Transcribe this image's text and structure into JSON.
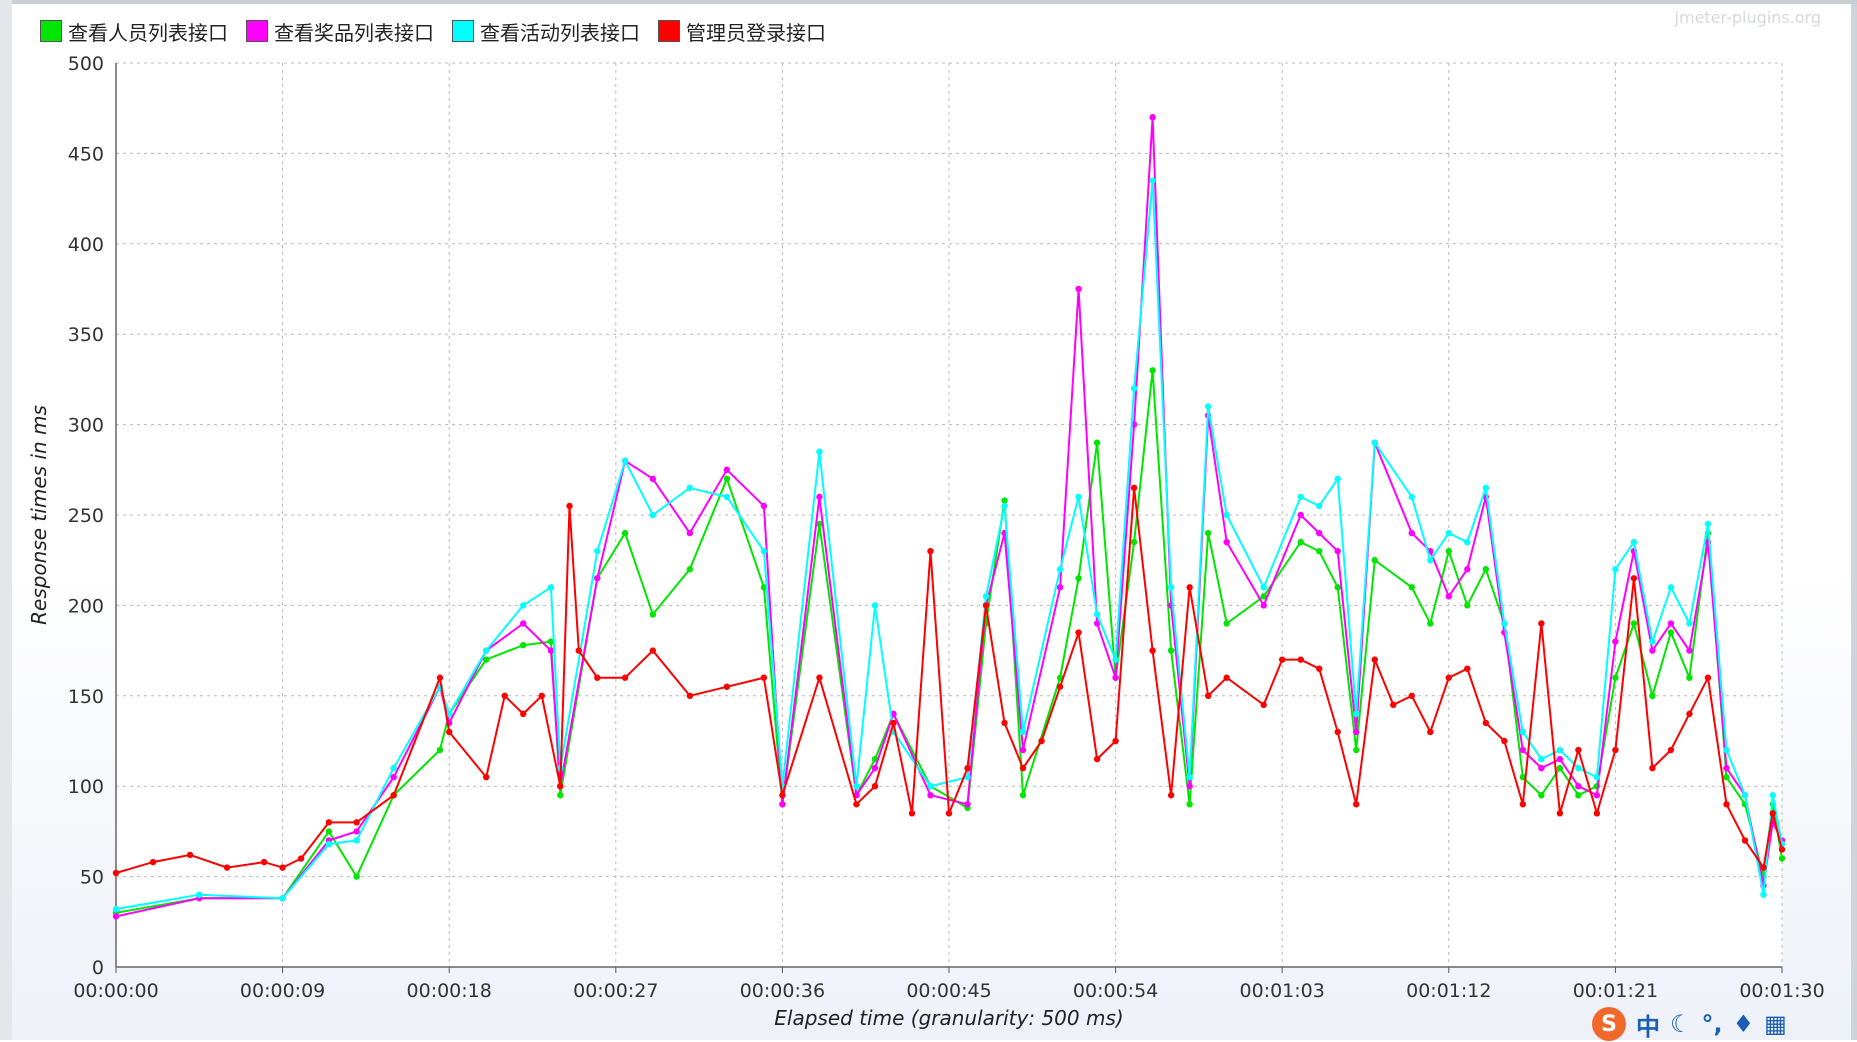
{
  "window": {
    "watermark": "jmeter-plugins.org"
  },
  "tray": {
    "logo": "S",
    "text": "中",
    "icons": [
      "ime-logo-icon",
      "moon-icon",
      "punctuation-icon",
      "shirt-icon",
      "grid-icon"
    ]
  },
  "chart_data": {
    "type": "line",
    "title": "",
    "xlabel": "Elapsed time (granularity: 500 ms)",
    "ylabel": "Response times in ms",
    "ylim": [
      0,
      500
    ],
    "yticks": [
      0,
      50,
      100,
      150,
      200,
      250,
      300,
      350,
      400,
      450,
      500
    ],
    "xlim_seconds": [
      0,
      90
    ],
    "xtick_seconds": [
      0,
      9,
      18,
      27,
      36,
      45,
      54,
      63,
      72,
      81,
      90
    ],
    "xticks": [
      "00:00:00",
      "00:00:09",
      "00:00:18",
      "00:00:27",
      "00:00:36",
      "00:00:45",
      "00:00:54",
      "00:01:03",
      "00:01:12",
      "00:01:21",
      "00:01:30"
    ],
    "grid": true,
    "legend_position": "top-left",
    "series": [
      {
        "name": "查看人员列表接口",
        "color": "#00e600",
        "points": [
          [
            0,
            30
          ],
          [
            4.5,
            38
          ],
          [
            9,
            38
          ],
          [
            11.5,
            75
          ],
          [
            13,
            50
          ],
          [
            15,
            95
          ],
          [
            17.5,
            120
          ],
          [
            18,
            140
          ],
          [
            20,
            170
          ],
          [
            22,
            178
          ],
          [
            23.5,
            180
          ],
          [
            24,
            95
          ],
          [
            26,
            215
          ],
          [
            27.5,
            240
          ],
          [
            29,
            195
          ],
          [
            31,
            220
          ],
          [
            33,
            270
          ],
          [
            35,
            210
          ],
          [
            36,
            90
          ],
          [
            38,
            245
          ],
          [
            40,
            95
          ],
          [
            41,
            115
          ],
          [
            42,
            140
          ],
          [
            44,
            100
          ],
          [
            46,
            88
          ],
          [
            47,
            190
          ],
          [
            48,
            258
          ],
          [
            49,
            95
          ],
          [
            51,
            160
          ],
          [
            52,
            215
          ],
          [
            53,
            290
          ],
          [
            54,
            160
          ],
          [
            55,
            235
          ],
          [
            56,
            330
          ],
          [
            57,
            175
          ],
          [
            58,
            90
          ],
          [
            59,
            240
          ],
          [
            60,
            190
          ],
          [
            62,
            205
          ],
          [
            64,
            235
          ],
          [
            65,
            230
          ],
          [
            66,
            210
          ],
          [
            67,
            120
          ],
          [
            68,
            225
          ],
          [
            70,
            210
          ],
          [
            71,
            190
          ],
          [
            72,
            230
          ],
          [
            73,
            200
          ],
          [
            74,
            220
          ],
          [
            75,
            190
          ],
          [
            76,
            105
          ],
          [
            77,
            95
          ],
          [
            78,
            110
          ],
          [
            79,
            95
          ],
          [
            80,
            100
          ],
          [
            81,
            160
          ],
          [
            82,
            190
          ],
          [
            83,
            150
          ],
          [
            84,
            185
          ],
          [
            85,
            160
          ],
          [
            86,
            240
          ],
          [
            87,
            105
          ],
          [
            88,
            90
          ],
          [
            89,
            50
          ],
          [
            89.5,
            90
          ],
          [
            90,
            60
          ]
        ]
      },
      {
        "name": "查看奖品列表接口",
        "color": "#ff00ff",
        "points": [
          [
            0,
            28
          ],
          [
            4.5,
            38
          ],
          [
            9,
            38
          ],
          [
            11.5,
            70
          ],
          [
            13,
            75
          ],
          [
            15,
            105
          ],
          [
            17.5,
            155
          ],
          [
            18,
            135
          ],
          [
            20,
            175
          ],
          [
            22,
            190
          ],
          [
            23.5,
            175
          ],
          [
            24,
            100
          ],
          [
            26,
            215
          ],
          [
            27.5,
            280
          ],
          [
            29,
            270
          ],
          [
            31,
            240
          ],
          [
            33,
            275
          ],
          [
            35,
            255
          ],
          [
            36,
            90
          ],
          [
            38,
            260
          ],
          [
            40,
            95
          ],
          [
            41,
            110
          ],
          [
            42,
            140
          ],
          [
            44,
            95
          ],
          [
            46,
            90
          ],
          [
            47,
            200
          ],
          [
            48,
            240
          ],
          [
            49,
            120
          ],
          [
            51,
            210
          ],
          [
            52,
            375
          ],
          [
            53,
            190
          ],
          [
            54,
            160
          ],
          [
            55,
            300
          ],
          [
            56,
            470
          ],
          [
            57,
            200
          ],
          [
            58,
            100
          ],
          [
            59,
            305
          ],
          [
            60,
            235
          ],
          [
            62,
            200
          ],
          [
            64,
            250
          ],
          [
            65,
            240
          ],
          [
            66,
            230
          ],
          [
            67,
            130
          ],
          [
            68,
            290
          ],
          [
            70,
            240
          ],
          [
            71,
            230
          ],
          [
            72,
            205
          ],
          [
            73,
            220
          ],
          [
            74,
            260
          ],
          [
            75,
            185
          ],
          [
            76,
            120
          ],
          [
            77,
            110
          ],
          [
            78,
            115
          ],
          [
            79,
            100
          ],
          [
            80,
            95
          ],
          [
            81,
            180
          ],
          [
            82,
            230
          ],
          [
            83,
            175
          ],
          [
            84,
            190
          ],
          [
            85,
            175
          ],
          [
            86,
            235
          ],
          [
            87,
            110
          ],
          [
            88,
            95
          ],
          [
            89,
            45
          ],
          [
            89.5,
            80
          ],
          [
            90,
            70
          ]
        ]
      },
      {
        "name": "查看活动列表接口",
        "color": "#00ffff",
        "points": [
          [
            0,
            32
          ],
          [
            4.5,
            40
          ],
          [
            9,
            38
          ],
          [
            11.5,
            68
          ],
          [
            13,
            70
          ],
          [
            15,
            110
          ],
          [
            17.5,
            155
          ],
          [
            18,
            140
          ],
          [
            20,
            175
          ],
          [
            22,
            200
          ],
          [
            23.5,
            210
          ],
          [
            24,
            110
          ],
          [
            26,
            230
          ],
          [
            27.5,
            280
          ],
          [
            29,
            250
          ],
          [
            31,
            265
          ],
          [
            33,
            260
          ],
          [
            35,
            230
          ],
          [
            36,
            100
          ],
          [
            38,
            285
          ],
          [
            40,
            100
          ],
          [
            41,
            200
          ],
          [
            42,
            130
          ],
          [
            44,
            100
          ],
          [
            46,
            105
          ],
          [
            47,
            205
          ],
          [
            48,
            255
          ],
          [
            49,
            130
          ],
          [
            51,
            220
          ],
          [
            52,
            260
          ],
          [
            53,
            195
          ],
          [
            54,
            170
          ],
          [
            55,
            320
          ],
          [
            56,
            435
          ],
          [
            57,
            210
          ],
          [
            58,
            105
          ],
          [
            59,
            310
          ],
          [
            60,
            250
          ],
          [
            62,
            210
          ],
          [
            64,
            260
          ],
          [
            65,
            255
          ],
          [
            66,
            270
          ],
          [
            67,
            140
          ],
          [
            68,
            290
          ],
          [
            70,
            260
          ],
          [
            71,
            225
          ],
          [
            72,
            240
          ],
          [
            73,
            235
          ],
          [
            74,
            265
          ],
          [
            75,
            190
          ],
          [
            76,
            130
          ],
          [
            77,
            115
          ],
          [
            78,
            120
          ],
          [
            79,
            110
          ],
          [
            80,
            105
          ],
          [
            81,
            220
          ],
          [
            82,
            235
          ],
          [
            83,
            180
          ],
          [
            84,
            210
          ],
          [
            85,
            190
          ],
          [
            86,
            245
          ],
          [
            87,
            120
          ],
          [
            88,
            95
          ],
          [
            89,
            40
          ],
          [
            89.5,
            95
          ],
          [
            90,
            68
          ]
        ]
      },
      {
        "name": "管理员登录接口",
        "color": "#ff0000",
        "points": [
          [
            0,
            52
          ],
          [
            2,
            58
          ],
          [
            4,
            62
          ],
          [
            6,
            55
          ],
          [
            8,
            58
          ],
          [
            9,
            55
          ],
          [
            10,
            60
          ],
          [
            11.5,
            80
          ],
          [
            13,
            80
          ],
          [
            15,
            95
          ],
          [
            17.5,
            160
          ],
          [
            18,
            130
          ],
          [
            20,
            105
          ],
          [
            21,
            150
          ],
          [
            22,
            140
          ],
          [
            23,
            150
          ],
          [
            24,
            100
          ],
          [
            24.5,
            255
          ],
          [
            25,
            175
          ],
          [
            26,
            160
          ],
          [
            27.5,
            160
          ],
          [
            29,
            175
          ],
          [
            31,
            150
          ],
          [
            33,
            155
          ],
          [
            35,
            160
          ],
          [
            36,
            95
          ],
          [
            38,
            160
          ],
          [
            40,
            90
          ],
          [
            41,
            100
          ],
          [
            42,
            135
          ],
          [
            43,
            85
          ],
          [
            44,
            230
          ],
          [
            45,
            85
          ],
          [
            46,
            110
          ],
          [
            47,
            200
          ],
          [
            48,
            135
          ],
          [
            49,
            110
          ],
          [
            50,
            125
          ],
          [
            51,
            155
          ],
          [
            52,
            185
          ],
          [
            53,
            115
          ],
          [
            54,
            125
          ],
          [
            55,
            265
          ],
          [
            56,
            175
          ],
          [
            57,
            95
          ],
          [
            58,
            210
          ],
          [
            59,
            150
          ],
          [
            60,
            160
          ],
          [
            62,
            145
          ],
          [
            63,
            170
          ],
          [
            64,
            170
          ],
          [
            65,
            165
          ],
          [
            66,
            130
          ],
          [
            67,
            90
          ],
          [
            68,
            170
          ],
          [
            69,
            145
          ],
          [
            70,
            150
          ],
          [
            71,
            130
          ],
          [
            72,
            160
          ],
          [
            73,
            165
          ],
          [
            74,
            135
          ],
          [
            75,
            125
          ],
          [
            76,
            90
          ],
          [
            77,
            190
          ],
          [
            78,
            85
          ],
          [
            79,
            120
          ],
          [
            80,
            85
          ],
          [
            81,
            120
          ],
          [
            82,
            215
          ],
          [
            83,
            110
          ],
          [
            84,
            120
          ],
          [
            85,
            140
          ],
          [
            86,
            160
          ],
          [
            87,
            90
          ],
          [
            88,
            70
          ],
          [
            89,
            55
          ],
          [
            89.5,
            85
          ],
          [
            90,
            65
          ]
        ]
      }
    ]
  }
}
